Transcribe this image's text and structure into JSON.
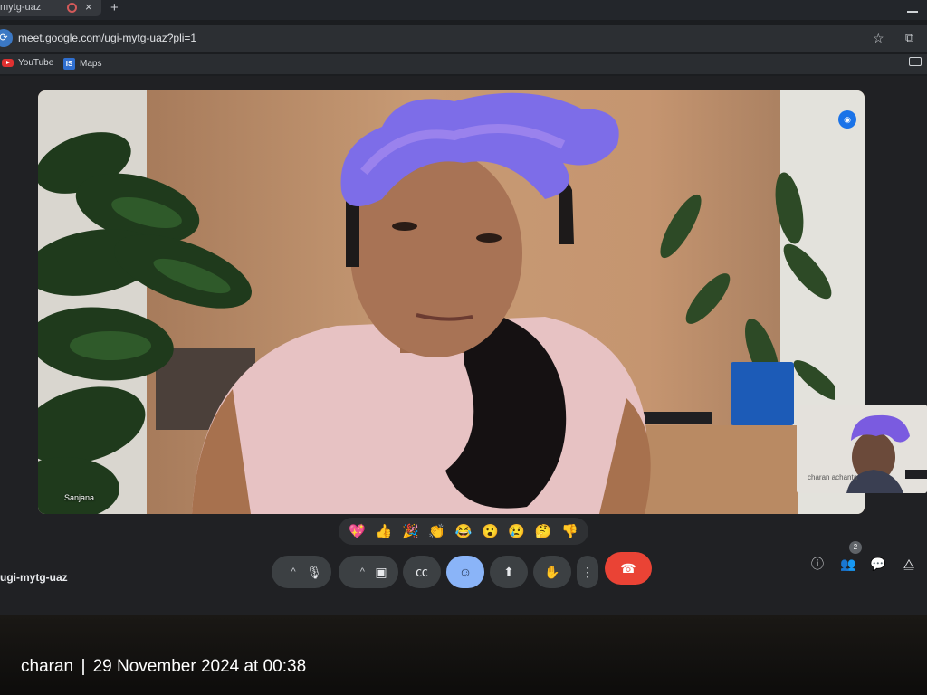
{
  "browser": {
    "tab_title": "mytg-uaz",
    "new_tab_label": "+",
    "tab_close_label": "×",
    "url": "meet.google.com/ugi-mytg-uaz?pli=1",
    "bookmarks": [
      {
        "label": "YouTube",
        "icon": "youtube-icon"
      },
      {
        "label": "Maps",
        "icon": "maps-icon"
      }
    ],
    "site_icon_label": "⟳"
  },
  "meet": {
    "main_participant": "Sanjana",
    "self_participant": "charan achanta",
    "meeting_code": "ugi-mytg-uaz",
    "participants_count": "2",
    "reactions": [
      "💖",
      "👍",
      "🎉",
      "👏",
      "😂",
      "😮",
      "😢",
      "🤔",
      "👎"
    ],
    "controls": {
      "mic_chevron": "^",
      "cam_chevron": "^"
    }
  },
  "photo_overlay": {
    "author": "charan",
    "timestamp": "29 November 2024 at 00:38"
  },
  "colors": {
    "accent_blue": "#8ab4f8",
    "end_call_red": "#ea4335",
    "meet_bg": "#202124"
  }
}
